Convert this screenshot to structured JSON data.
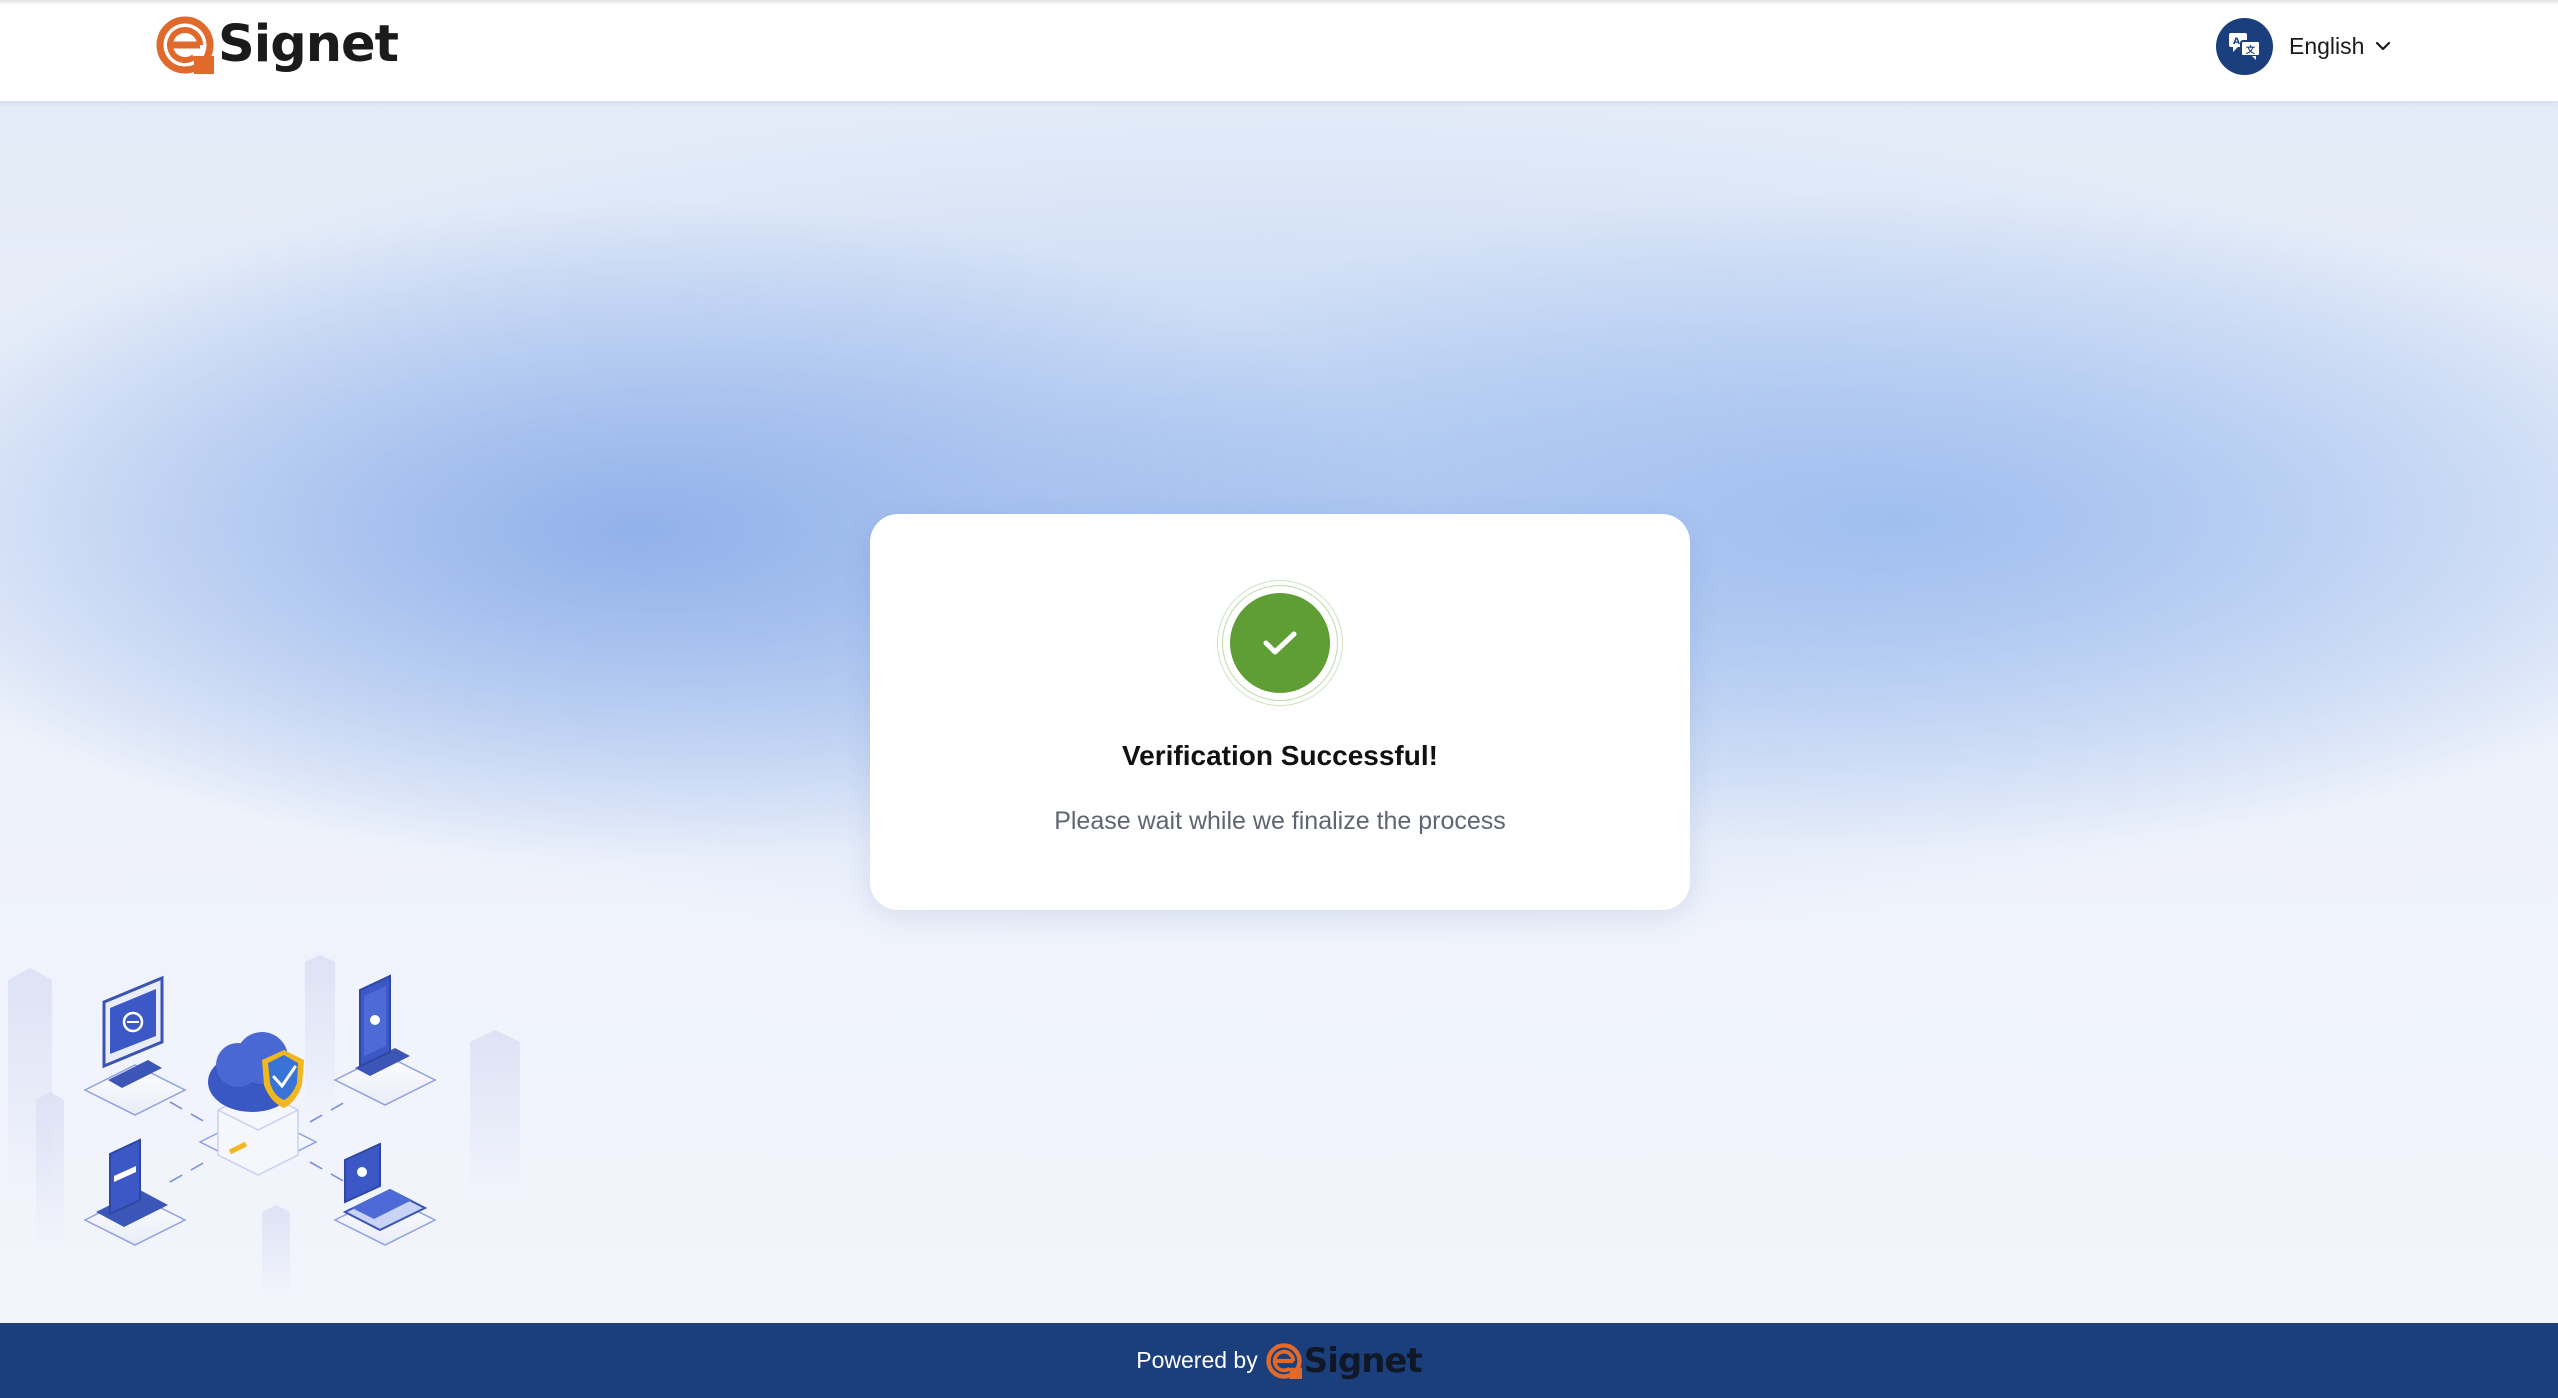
{
  "header": {
    "brand_name": "Signet",
    "language": {
      "selected": "English",
      "icon": "translate-icon"
    }
  },
  "card": {
    "status_icon": "check-icon",
    "title": "Verification Successful!",
    "subtitle": "Please wait while we finalize the process"
  },
  "footer": {
    "powered_by": "Powered by",
    "brand_name": "Signet"
  },
  "colors": {
    "brand_orange": "#e06a2c",
    "navy": "#1b3f7d",
    "success_green": "#5e9e34",
    "text_muted": "#5f6573"
  }
}
